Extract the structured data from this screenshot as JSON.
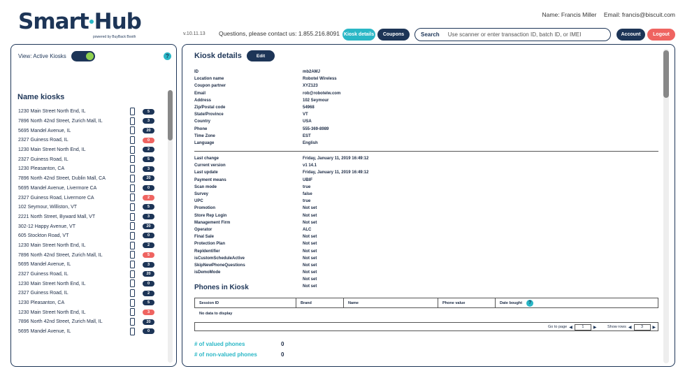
{
  "brand": {
    "name_part1": "Smart",
    "name_part2": "Hub",
    "tagline": "powered by BuyBack Booth"
  },
  "header": {
    "version": "v.10.11.13",
    "contact": "Questions, please contact us: 1.855.216.8091",
    "user_name": "Name: Francis Miller",
    "user_email": "Email: francis@biscuit.com",
    "kiosk_details_label": "Kiosk details",
    "coupons_label": "Coupons",
    "search_label": "Search",
    "search_placeholder": "Use scanner or enter transaction ID, batch ID, or IMEI",
    "account_label": "Account",
    "logout_label": "Logout"
  },
  "left": {
    "view_label": "View: Active Kiosks",
    "toggle_on": true,
    "help_glyph": "?",
    "title": "Name kiosks",
    "kiosks": [
      {
        "name": "1230 Main Street North End, IL",
        "count": "5",
        "alert": false
      },
      {
        "name": "7896 North 42nd Street, Zurich Mall, IL",
        "count": "3",
        "alert": false
      },
      {
        "name": "5695 Mandel Avenue, IL",
        "count": "20",
        "alert": false
      },
      {
        "name": "2327 Guiness Road, IL",
        "count": "0",
        "alert": true
      },
      {
        "name": "1230 Main Street North End, IL",
        "count": "2",
        "alert": false
      },
      {
        "name": "2327 Guiness Road, IL",
        "count": "5",
        "alert": false
      },
      {
        "name": "1230 Pleasanton, CA",
        "count": "3",
        "alert": false
      },
      {
        "name": "7896 North 42nd Street, Dublin Mall, CA",
        "count": "20",
        "alert": false
      },
      {
        "name": "5695 Mandel Avenue, Livermore CA",
        "count": "0",
        "alert": false
      },
      {
        "name": "2327 Guiness Road, Livermore CA",
        "count": "2",
        "alert": true
      },
      {
        "name": "102 Seymour,  Williston, VT",
        "count": "5",
        "alert": false
      },
      {
        "name": "2221 North Street, Byward Mall, VT",
        "count": "3",
        "alert": false
      },
      {
        "name": "302-12 Happy Avenue, VT",
        "count": "20",
        "alert": false
      },
      {
        "name": "605 Stockton Road, VT",
        "count": "0",
        "alert": false
      },
      {
        "name": "1230 Main Street North End, IL",
        "count": "2",
        "alert": false
      },
      {
        "name": "7896 North 42nd Street, Zurich Mall, IL",
        "count": "5",
        "alert": true
      },
      {
        "name": "5695 Mandel Avenue, IL",
        "count": "3",
        "alert": false
      },
      {
        "name": "2327 Guiness Road, IL",
        "count": "20",
        "alert": false
      },
      {
        "name": "1230 Main Street North End, IL",
        "count": "0",
        "alert": false
      },
      {
        "name": "2327 Guiness Road, IL",
        "count": "2",
        "alert": false
      },
      {
        "name": "1230 Pleasanton, CA",
        "count": "5",
        "alert": false
      },
      {
        "name": "1230 Main Street North End, IL",
        "count": "3",
        "alert": true
      },
      {
        "name": "7896 North 42nd Street, Zurich Mall, IL",
        "count": "20",
        "alert": false
      },
      {
        "name": "5695 Mandel Avenue, IL",
        "count": "0",
        "alert": false
      }
    ]
  },
  "details": {
    "title": "Kiosk details",
    "edit_label": "Edit",
    "group1": [
      {
        "key": "ID",
        "value": "mb2AMJ"
      },
      {
        "key": "Location name",
        "value": "Robotel Wireless"
      },
      {
        "key": "Coupon partner",
        "value": "XYZ123"
      },
      {
        "key": "Email",
        "value": "rob@robotelw.com"
      },
      {
        "key": "Address",
        "value": "102 Seymour"
      },
      {
        "key": "Zip/Postal code",
        "value": "54968"
      },
      {
        "key": "State/Province",
        "value": "VT"
      },
      {
        "key": "Country",
        "value": "USA"
      },
      {
        "key": "Phone",
        "value": "555-369-8989"
      },
      {
        "key": "Time Zone",
        "value": "EST"
      },
      {
        "key": "Language",
        "value": "English"
      }
    ],
    "group2": [
      {
        "key": "Last change",
        "value": "Friday, January 11, 2019 16:49:12"
      },
      {
        "key": "Current version",
        "value": "v1 14.1"
      },
      {
        "key": "Last update",
        "value": "Friday, January 11, 2019 16:49:12"
      },
      {
        "key": "Payment means",
        "value": "UBIF"
      },
      {
        "key": "Scan mode",
        "value": "true"
      },
      {
        "key": "Survey",
        "value": "false"
      },
      {
        "key": "UPC",
        "value": "true"
      },
      {
        "key": "Promotion",
        "value": "Not set"
      },
      {
        "key": "Store Rep Login",
        "value": "Not set"
      },
      {
        "key": "Management Firm",
        "value": "Not set"
      },
      {
        "key": "Operator",
        "value": "ALC"
      },
      {
        "key": "Final Sale",
        "value": "Not set"
      },
      {
        "key": "Protection Plan",
        "value": "Not set"
      },
      {
        "key": "RepIdentifier",
        "value": "Not set"
      },
      {
        "key": "isCustomScheduleActive",
        "value": "Not set"
      },
      {
        "key": "SkipNewPhoneQuestions",
        "value": "Not set"
      },
      {
        "key": "isDemoMode",
        "value": "Not set"
      },
      {
        "key": "",
        "value": "Not set"
      },
      {
        "key": "",
        "value": "Not set"
      }
    ]
  },
  "phones": {
    "title": "Phones in Kiosk",
    "columns": [
      "Session ID",
      "Brand",
      "Name",
      "Phone value",
      "Date bought"
    ],
    "empty_text": "No data to display",
    "goto_label": "Go to page",
    "page_value": "1",
    "rows_label": "Show rows",
    "rows_value": "3",
    "prev_glyph": "◀",
    "next_glyph": "▶"
  },
  "stats": {
    "valued_label": "# of valued phones",
    "valued_value": "0",
    "nonvalued_label": "# of non-valued phones",
    "nonvalued_value": "0"
  },
  "colors": {
    "navy": "#1d3557",
    "teal": "#2ab7c6",
    "red": "#ef6461",
    "toggle_knob": "#8fd14f"
  }
}
